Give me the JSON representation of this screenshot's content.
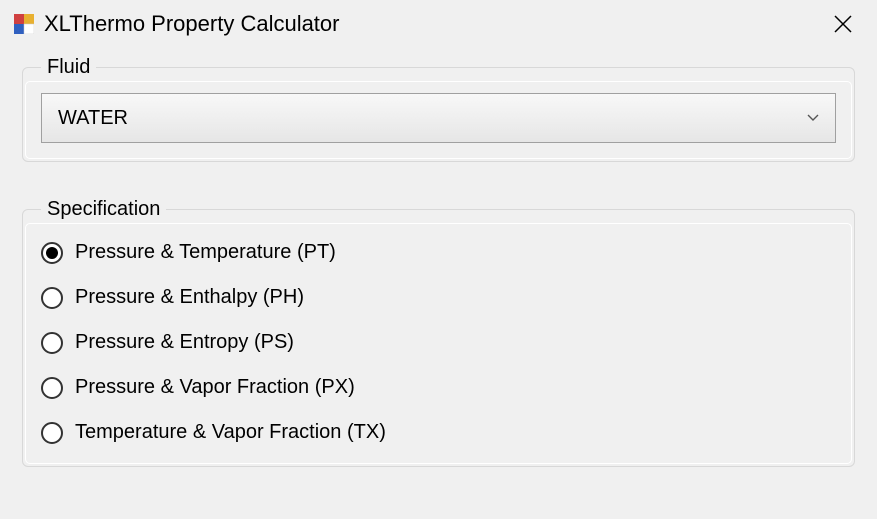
{
  "window": {
    "title": "XLThermo Property Calculator"
  },
  "fluid": {
    "legend": "Fluid",
    "selected": "WATER"
  },
  "specification": {
    "legend": "Specification",
    "options": [
      {
        "label": "Pressure & Temperature (PT)",
        "checked": true
      },
      {
        "label": "Pressure & Enthalpy (PH)",
        "checked": false
      },
      {
        "label": "Pressure & Entropy (PS)",
        "checked": false
      },
      {
        "label": "Pressure & Vapor Fraction (PX)",
        "checked": false
      },
      {
        "label": "Temperature & Vapor Fraction (TX)",
        "checked": false
      }
    ]
  }
}
